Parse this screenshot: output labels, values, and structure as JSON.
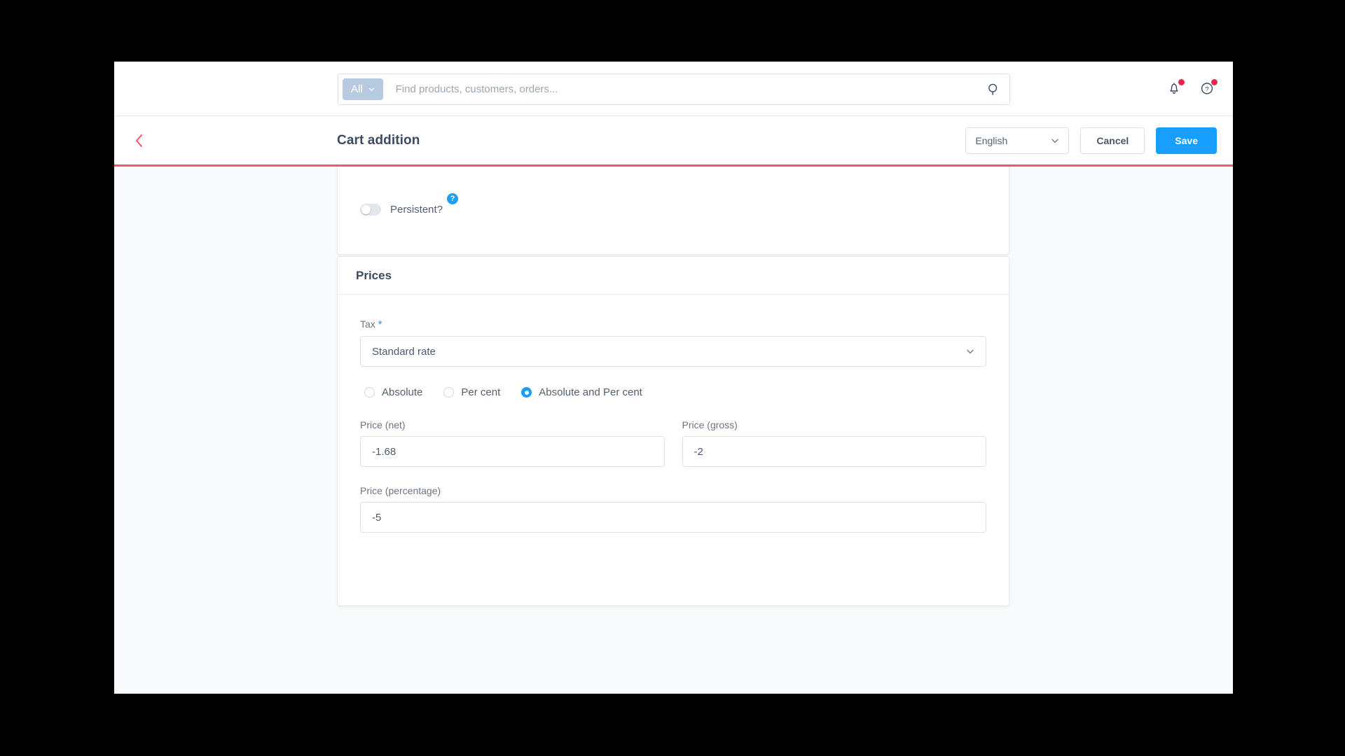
{
  "topbar": {
    "scope_label": "All",
    "scope_caret_icon": "chevron-down-icon",
    "search_placeholder": "Find products, customers, orders...",
    "search_value": "",
    "search_icon": "search-icon",
    "notifications_icon": "bell-icon",
    "help_icon": "question-circle-icon"
  },
  "header": {
    "back_icon": "chevron-left-icon",
    "title": "Cart addition",
    "language_value": "English",
    "language_caret_icon": "chevron-down-icon",
    "cancel_label": "Cancel",
    "save_label": "Save"
  },
  "persistent_card": {
    "toggle_label": "Persistent?",
    "toggle_state": "off",
    "help_badge_label": "?"
  },
  "prices_card": {
    "title": "Prices",
    "tax": {
      "label": "Tax",
      "required_marker": "*",
      "value": "Standard rate",
      "caret_icon": "chevron-down-icon"
    },
    "price_mode": {
      "options": [
        {
          "label": "Absolute",
          "selected": false
        },
        {
          "label": "Per cent",
          "selected": false
        },
        {
          "label": "Absolute and Per cent",
          "selected": true
        }
      ]
    },
    "price_net": {
      "label": "Price (net)",
      "value": "-1.68"
    },
    "price_gross": {
      "label": "Price (gross)",
      "value": "-2"
    },
    "price_percentage": {
      "label": "Price (percentage)",
      "value": "-5"
    }
  },
  "colors": {
    "accent_blue": "#189eff",
    "header_underline": "#f4546f",
    "badge_red": "#e8254d",
    "scope_pill": "#b6cbe0",
    "page_bg": "#f9fafb"
  }
}
